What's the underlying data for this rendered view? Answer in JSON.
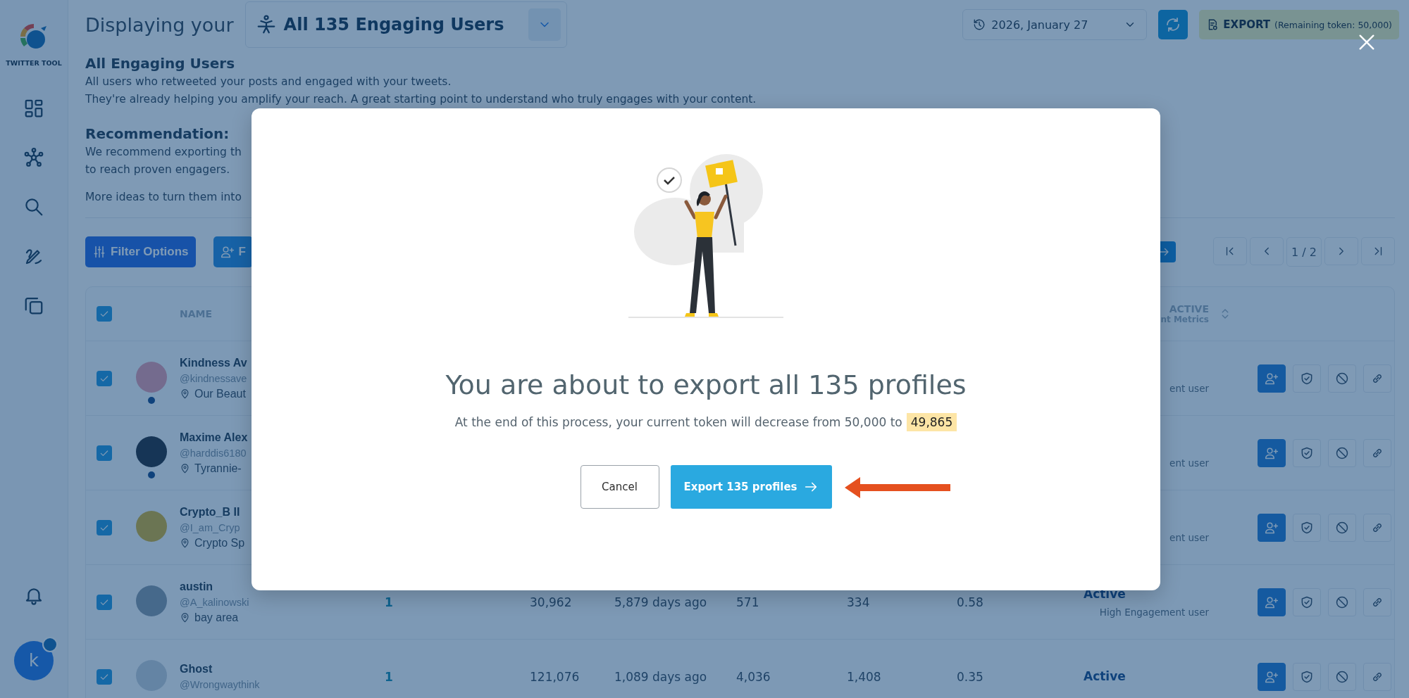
{
  "sidebar": {
    "logo_label": "TWITTER TOOL",
    "avatar_letter": "k"
  },
  "header": {
    "prefix": "Displaying your",
    "segment": "All 135 Engaging Users",
    "date": "2026, January 27",
    "export_label": "EXPORT",
    "export_note": "(Remaining token: 50,000)"
  },
  "intro": {
    "title": "All Engaging Users",
    "lines": [
      "All users who retweeted your posts and engaged with your tweets.",
      "They're already helping you amplify your reach. A great starting point to understand who truly engages with your content."
    ],
    "recommendation_title": "Recommendation:",
    "recommendation_lines": [
      "We recommend exporting th",
      "to reach proven engagers."
    ],
    "more": "More ideas to turn them into"
  },
  "toolbar": {
    "filter_label": "Filter Options",
    "second_label": "F",
    "page": "1 / 2"
  },
  "table": {
    "header_checked": true,
    "name_column": "NAME",
    "status_column": "ACTIVE",
    "status_column_note": "nt Metrics",
    "rows": [
      {
        "checked": true,
        "dot": true,
        "name": "Kindness Av",
        "handle": "@kindnessave",
        "location": "Our Beaut",
        "status_note": "ent user"
      },
      {
        "checked": true,
        "dot": true,
        "name": "Maxime Alex",
        "handle": "@harddis6180",
        "location": "Tyrannie-",
        "status_note": "ent user"
      },
      {
        "checked": true,
        "dot": false,
        "name": "Crypto_B II",
        "handle": "@I_am_Cryp",
        "location": "Crypto Sp",
        "status_note": "ent user"
      },
      {
        "checked": true,
        "dot": false,
        "name": "austin",
        "handle": "@A_kalinowski",
        "location": "bay area",
        "values": [
          "1",
          "30,962",
          "5,879 days ago",
          "571",
          "334",
          "0.58"
        ],
        "status": "Active",
        "status_note": "High Engagement user"
      },
      {
        "checked": true,
        "dot": false,
        "name": "Ghost",
        "handle": "@Wrongwaythink",
        "values": [
          "1",
          "121,076",
          "1,089 days ago",
          "4,036",
          "1,408",
          "0.35"
        ],
        "status": "Active"
      }
    ]
  },
  "dialog": {
    "title": "You are about to export all 135 profiles",
    "text": "At the end of this process, your current token will decrease from 50,000 to",
    "result": "49,865",
    "cancel": "Cancel",
    "confirm": "Export 135 profiles"
  }
}
